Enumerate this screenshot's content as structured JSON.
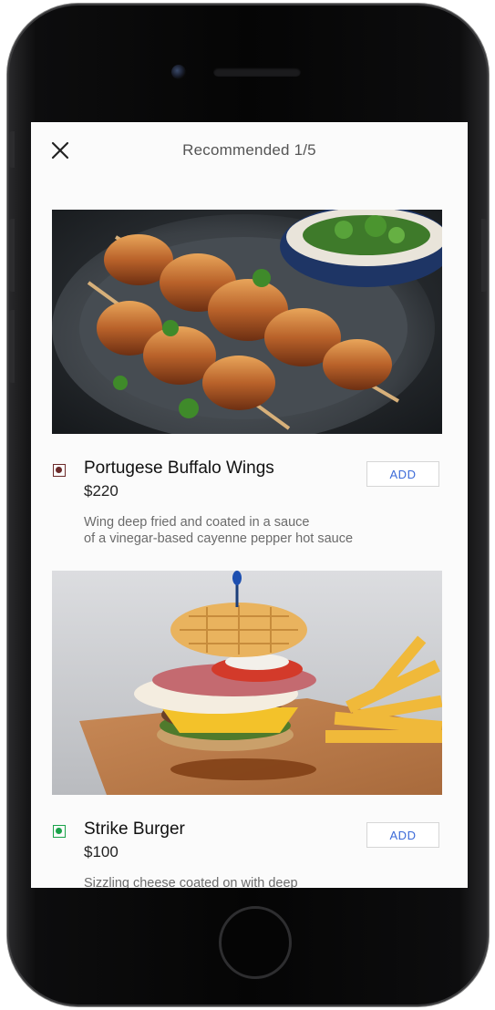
{
  "header": {
    "title": "Recommended 1/5",
    "close_icon": "close-icon"
  },
  "items": [
    {
      "name": "Portugese Buffalo Wings",
      "price": "$220",
      "description_lines": [
        "Wing deep fried and coated in a sauce",
        "of a vinegar-based cayenne pepper hot sauce"
      ],
      "add_label": "ADD",
      "diet_indicator": "non-veg",
      "diet_color": "#6b2a2a",
      "image_icon": "chicken-skewers-image"
    },
    {
      "name": "Strike Burger",
      "price": "$100",
      "description_lines": [
        "Sizzling cheese coated on with deep"
      ],
      "add_label": "ADD",
      "diet_indicator": "veg",
      "diet_color": "#1aa34a",
      "image_icon": "burger-fries-image"
    }
  ],
  "colors": {
    "accent": "#3b6ad8",
    "screen_bg": "#fbfbfb",
    "device_frame": "#0a0a0a"
  }
}
